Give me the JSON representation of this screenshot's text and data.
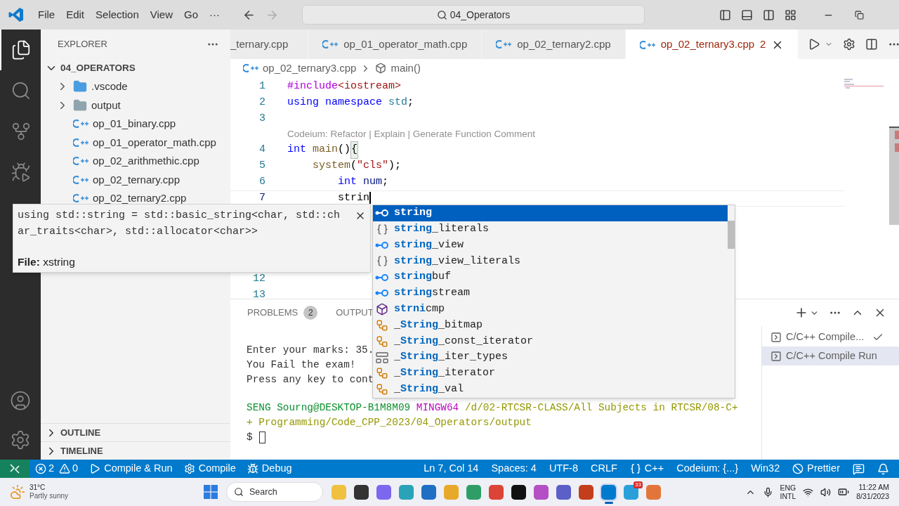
{
  "title_bar": {
    "menu": [
      "File",
      "Edit",
      "Selection",
      "View",
      "Go",
      "···"
    ],
    "search": "04_Operators"
  },
  "activity_bar": [
    {
      "kind": "explorer",
      "selected": true
    },
    {
      "kind": "search",
      "selected": false
    },
    {
      "kind": "source-control",
      "selected": false
    },
    {
      "kind": "run-debug",
      "selected": false
    }
  ],
  "sidebar": {
    "title": "EXPLORER",
    "folder": {
      "label": "04_OPERATORS",
      "expanded": true,
      "children": [
        {
          "label": ".vscode",
          "kind": "vscode-folder",
          "expanded": false
        },
        {
          "label": "output",
          "kind": "folder",
          "expanded": false
        },
        {
          "label": "op_01_binary.cpp",
          "kind": "cpp"
        },
        {
          "label": "op_01_operator_math.cpp",
          "kind": "cpp"
        },
        {
          "label": "op_02_arithmethic.cpp",
          "kind": "cpp"
        },
        {
          "label": "op_02_ternary.cpp",
          "kind": "cpp"
        },
        {
          "label": "op_02_ternary2.cpp",
          "kind": "cpp"
        }
      ]
    },
    "sections": [
      {
        "label": "OUTLINE",
        "expanded": false
      },
      {
        "label": "TIMELINE",
        "expanded": false
      }
    ]
  },
  "tabs": [
    {
      "label": "_ternary.cpp",
      "selected": false,
      "cut": true
    },
    {
      "label": "op_01_operator_math.cpp",
      "selected": false
    },
    {
      "label": "op_02_ternary2.cpp",
      "selected": false
    },
    {
      "label": "op_02_ternary3.cpp",
      "selected": true,
      "problems": "2"
    }
  ],
  "breadcrumbs": {
    "file": "op_02_ternary3.cpp",
    "symbol": "main()"
  },
  "code": {
    "lines": [
      {
        "kind": "code",
        "number": "1",
        "current": false,
        "tokens": [
          {
            "text": "#include",
            "kind": "directive"
          },
          {
            "text": "<iostream>",
            "kind": "string"
          }
        ]
      },
      {
        "kind": "code",
        "number": "2",
        "current": false,
        "tokens": [
          {
            "text": "using namespace",
            "kind": "keyword"
          },
          {
            "text": " std",
            "kind": "type"
          },
          {
            "text": ";",
            "kind": "plain"
          }
        ]
      },
      {
        "kind": "code",
        "number": "3",
        "current": false
      },
      {
        "kind": "codelens",
        "text": "Codeium: Refactor | Explain | Generate Function Comment"
      },
      {
        "kind": "code",
        "number": "4",
        "current": false,
        "tokens": [
          {
            "text": "int",
            "kind": "keyword"
          },
          {
            "text": " main",
            "kind": "function"
          },
          {
            "text": "()",
            "kind": "plain"
          },
          {
            "text": "{",
            "kind": "bracket-match"
          }
        ]
      },
      {
        "kind": "code",
        "number": "5",
        "current": false,
        "tokens": [
          {
            "text": "    system",
            "kind": "function"
          },
          {
            "text": "(",
            "kind": "plain"
          },
          {
            "text": "\"cls\"",
            "kind": "string"
          },
          {
            "text": ");",
            "kind": "plain"
          }
        ]
      },
      {
        "kind": "code",
        "number": "6",
        "current": false,
        "tokens": [
          {
            "text": "        int",
            "kind": "keyword"
          },
          {
            "text": " num",
            "kind": "variable"
          },
          {
            "text": ";",
            "kind": "plain"
          }
        ]
      },
      {
        "kind": "code",
        "number": "7",
        "current": true,
        "tokens": [
          {
            "text": "        strin",
            "kind": "plain"
          }
        ]
      }
    ],
    "lower_lines": [
      {
        "number": "12"
      },
      {
        "number": "13"
      }
    ]
  },
  "hover": {
    "lines": [
      "using std::string = std::basic_string<char, std::ch",
      "ar_traits<char>, std::allocator<char>>"
    ],
    "file": "**File:** xstring"
  },
  "suggest": [
    {
      "label": "**string**",
      "kind": "variable",
      "selected": true
    },
    {
      "label": "**string**_literals",
      "kind": "namespace",
      "selected": false
    },
    {
      "label": "**string**_view",
      "kind": "variable",
      "selected": false
    },
    {
      "label": "**string**_view_literals",
      "kind": "namespace",
      "selected": false
    },
    {
      "label": "**string**buf",
      "kind": "variable",
      "selected": false
    },
    {
      "label": "**string**stream",
      "kind": "variable",
      "selected": false
    },
    {
      "label": "**strni**cmp",
      "kind": "function",
      "selected": false
    },
    {
      "label": "_**String**_bitmap",
      "kind": "class",
      "selected": false
    },
    {
      "label": "_**String**_const_iterator",
      "kind": "class",
      "selected": false
    },
    {
      "label": "_**String**_iter_types",
      "kind": "struct",
      "selected": false
    },
    {
      "label": "_**String**_iterator",
      "kind": "class",
      "selected": false
    },
    {
      "label": "_**String**_val",
      "kind": "class",
      "selected": false
    }
  ],
  "panel": {
    "tabs": [
      {
        "label": "PROBLEMS",
        "badge": "2",
        "selected": false
      },
      {
        "label": "OUTPUT",
        "selected": false
      }
    ],
    "terminal": {
      "output": [
        [
          {
            "text": "Enter your marks: 35.",
            "kind": "plain"
          }
        ],
        [
          {
            "text": "You Fail the exam!",
            "kind": "plain"
          }
        ],
        [
          {
            "text": "Press any key to cont",
            "kind": "plain"
          }
        ]
      ],
      "prompt": [
        [
          {
            "text": "SENG Sourng@DESKTOP-B1M8M09",
            "kind": "user"
          },
          {
            "text": " MINGW64",
            "kind": "host"
          },
          {
            "text": " /d/02-RTCSR-CLASS/All Subjects in RTCSR/08-C+",
            "kind": "path"
          }
        ],
        [
          {
            "text": "+ Programming/Code_CPP_2023/04_Operators/output",
            "kind": "path"
          }
        ],
        [
          {
            "text": "$",
            "kind": "plain"
          }
        ]
      ],
      "cursor": true
    },
    "terminals": [
      {
        "label": "C/C++ Compile...",
        "checked": true,
        "selected": false
      },
      {
        "label": "C/C++ Compile Run",
        "checked": false,
        "selected": true
      }
    ]
  },
  "status_bar": {
    "errors": "2",
    "warnings": "0",
    "left": [
      {
        "label": "Compile & Run",
        "kind": "play"
      },
      {
        "label": "Compile",
        "kind": "gear"
      },
      {
        "label": "Debug",
        "kind": "bug"
      }
    ],
    "right": [
      {
        "label": "Ln 7, Col 14"
      },
      {
        "label": "Spaces: 4"
      },
      {
        "label": "UTF-8"
      },
      {
        "label": "CRLF"
      },
      {
        "label": "C++",
        "kind": "braces"
      },
      {
        "label": "Codeium: {...}"
      },
      {
        "label": "Win32"
      },
      {
        "label": "Prettier",
        "kind": "ban"
      }
    ]
  },
  "taskbar": {
    "weather": {
      "temp": "31°C",
      "text": "Partly sunny"
    },
    "search": "Search",
    "apps": [
      {
        "color": "#f0c040",
        "selected": false
      },
      {
        "color": "#333333",
        "selected": false
      },
      {
        "color": "#7b68ee",
        "selected": false
      },
      {
        "color": "#2aa3b8",
        "selected": false
      },
      {
        "color": "#1f6fc5",
        "selected": false
      },
      {
        "color": "#e8a92b",
        "selected": false
      },
      {
        "color": "#2f9e66",
        "selected": false
      },
      {
        "color": "#db4437",
        "selected": false
      },
      {
        "color": "#111111",
        "selected": false
      },
      {
        "color": "#b44fc4",
        "selected": false
      },
      {
        "color": "#5b5fc7",
        "selected": false
      },
      {
        "color": "#c43e1c",
        "selected": false
      },
      {
        "color": "#007acc",
        "selected": true
      },
      {
        "color": "#2aa0da",
        "selected": false,
        "badge": "33"
      },
      {
        "color": "#e2763a",
        "selected": false
      }
    ],
    "lang": [
      "ENG",
      "INTL"
    ],
    "time": "11:22 AM",
    "date": "8/31/2023"
  }
}
